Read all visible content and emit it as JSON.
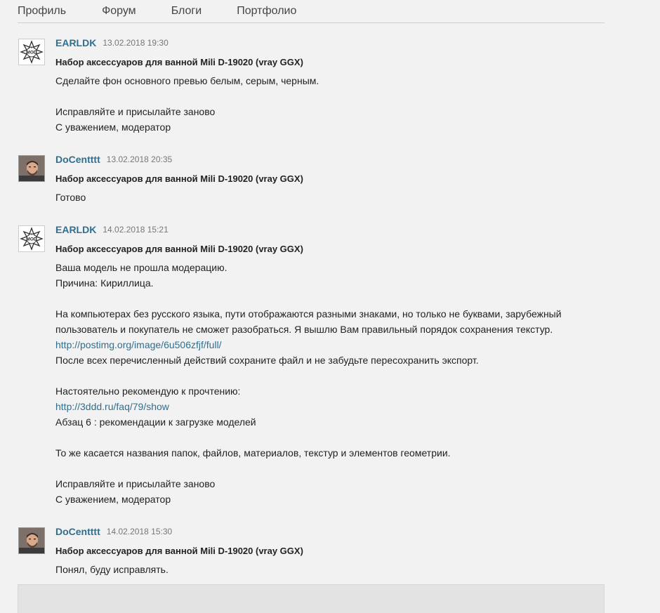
{
  "nav": {
    "items": [
      "Профиль",
      "Форум",
      "Блоги",
      "Портфолио"
    ]
  },
  "messages": [
    {
      "author": "EARLDK",
      "date": "13.02.2018 19:30",
      "avatar": "mod-badge-icon",
      "subject": "Набор аксессуаров для ванной Mili D-19020 (vray GGX)",
      "lines": [
        "Сделайте фон основного превью белым, серым, черным.",
        "",
        "Исправляйте и присылайте заново",
        "С уважением, модератор"
      ]
    },
    {
      "author": "DoCentttt",
      "date": "13.02.2018 20:35",
      "avatar": "user-photo",
      "subject": "Набор аксессуаров для ванной Mili D-19020 (vray GGX)",
      "lines": [
        "Готово"
      ]
    },
    {
      "author": "EARLDK",
      "date": "14.02.2018 15:21",
      "avatar": "mod-badge-icon",
      "subject": "Набор аксессуаров для ванной Mili D-19020 (vray GGX)",
      "lines": [
        "Ваша модель не прошла модерацию.",
        "Причина: Кириллица.",
        "",
        "На компьютерах без русского языка, пути отображаются разными знаками, но только не буквами, зарубежный",
        "пользователь и покупатель не сможет разобраться. Я вышлю Вам правильный порядок сохранения текстур.",
        "http://postimg.org/image/6u506zfjf/full/",
        "После всех перечисленный действий сохраните файл и не забудьте пересохранить экспорт.",
        "",
        "Настоятельно рекомендую к прочтению:",
        "http://3ddd.ru/faq/79/show",
        "Абзац 6 : рекомендации к загрузке моделей",
        "",
        "То же касается названия папок, файлов, материалов, текстур и элементов геометрии.",
        "",
        "Исправляйте и присылайте заново",
        "С уважением, модератор"
      ]
    },
    {
      "author": "DoCentttt",
      "date": "14.02.2018 15:30",
      "avatar": "user-photo",
      "subject": "Набор аксессуаров для ванной Mili D-19020 (vray GGX)",
      "lines": [
        "Понял, буду исправлять."
      ]
    }
  ],
  "badge_text": "MOD",
  "colors": {
    "author": "#2f6f8f",
    "link": "#2f6f8f",
    "background": "#f2f2f2"
  }
}
